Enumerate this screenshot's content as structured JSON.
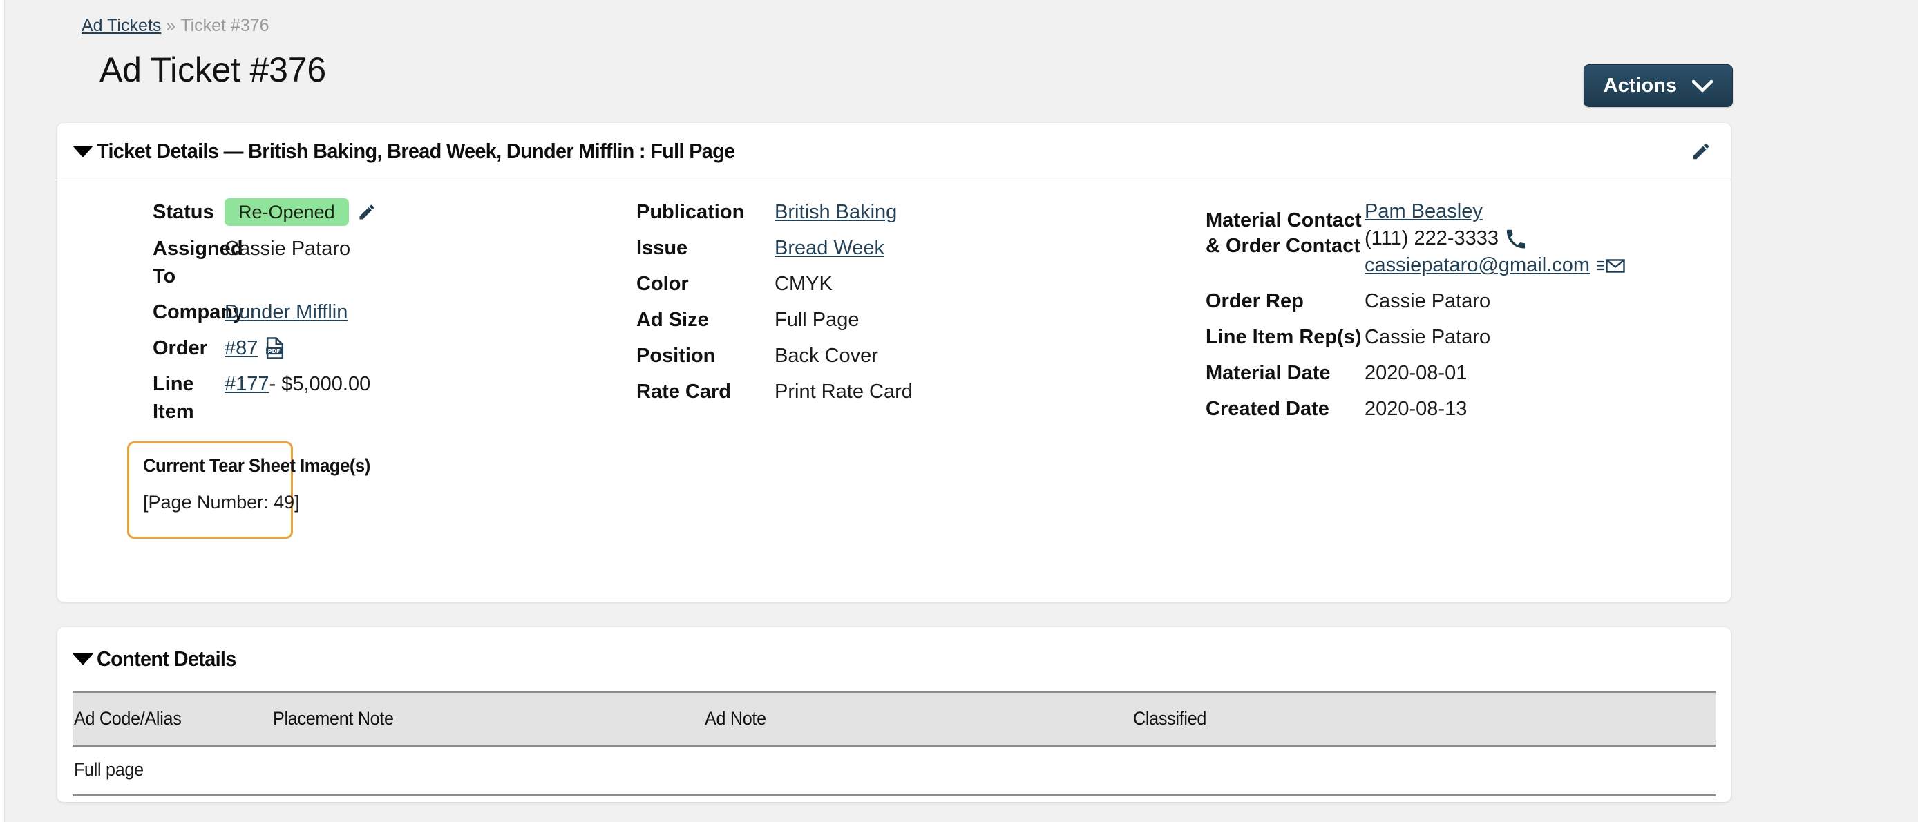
{
  "breadcrumb": {
    "root_label": "Ad Tickets",
    "separator": "»",
    "current_label": "Ticket #376"
  },
  "header": {
    "title": "Ad Ticket #376",
    "actions_label": "Actions",
    "actions_caret_icon": "chevron-down-icon"
  },
  "ticket_details": {
    "section_title": "Ticket Details — British Baking, Bread Week, Dunder Mifflin : Full Page",
    "edit_icon": "pencil-icon",
    "column_1": [
      {
        "label": "Status",
        "value": "Re-Opened",
        "type": "badge",
        "badge_color": "#8FE39A",
        "edit_icon": "pencil-icon"
      },
      {
        "label": "Assigned To",
        "value": "Cassie Pataro",
        "type": "text"
      },
      {
        "label": "Company",
        "value": "Dunder Mifflin",
        "type": "link"
      },
      {
        "label": "Order",
        "value": "#87",
        "type": "link",
        "icon": "pdf-file-icon"
      },
      {
        "label": "Line Item",
        "value": "#177",
        "suffix": " - $5,000.00",
        "type": "link"
      }
    ],
    "column_2": [
      {
        "label": "Publication",
        "value": "British Baking",
        "type": "link"
      },
      {
        "label": "Issue",
        "value": "Bread Week",
        "type": "link"
      },
      {
        "label": "Color",
        "value": "CMYK",
        "type": "text"
      },
      {
        "label": "Ad Size",
        "value": "Full Page",
        "type": "text"
      },
      {
        "label": "Position",
        "value": "Back Cover",
        "type": "text"
      },
      {
        "label": "Rate Card",
        "value": "Print Rate Card",
        "type": "text"
      }
    ],
    "column_3": {
      "contact": {
        "label_line_1": "Material Contact",
        "label_line_2": "& Order Contact",
        "name": "Pam Beasley",
        "phone": "(111) 222-3333",
        "phone_icon": "phone-icon",
        "email": "cassiepataro@gmail.com",
        "email_icon": "send-email-icon"
      },
      "rows": [
        {
          "label": "Order Rep",
          "value": "Cassie Pataro"
        },
        {
          "label": "Line Item Rep(s)",
          "value": "Cassie Pataro"
        },
        {
          "label": "Material Date",
          "value": "2020-08-01"
        },
        {
          "label": "Created Date",
          "value": "2020-08-13"
        }
      ]
    },
    "tear_sheet": {
      "title": "Current Tear Sheet Image(s)",
      "detail": "[Page Number: 49]",
      "border_color": "#E8A33D"
    }
  },
  "content_details": {
    "section_title": "Content Details",
    "columns": [
      "Ad Code/Alias",
      "Placement Note",
      "Ad Note",
      "Classified"
    ],
    "rows": [
      {
        "ad_code_alias": "Full page",
        "placement_note": "",
        "ad_note": "",
        "classified": ""
      }
    ]
  }
}
